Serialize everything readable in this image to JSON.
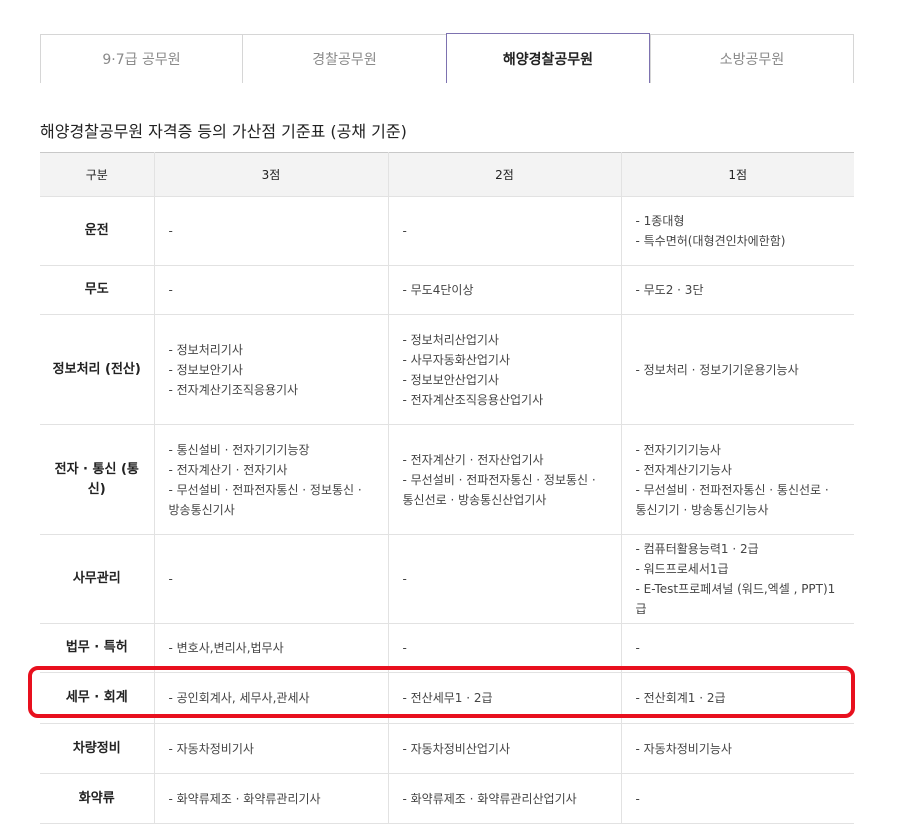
{
  "tabs": [
    {
      "label": "9·7급 공무원",
      "active": false
    },
    {
      "label": "경찰공무원",
      "active": false
    },
    {
      "label": "해양경찰공무원",
      "active": true
    },
    {
      "label": "소방공무원",
      "active": false
    }
  ],
  "title": "해양경찰공무원 자격증 등의 가산점 기준표 (공채 기준)",
  "table": {
    "headers": [
      "구분",
      "3점",
      "2점",
      "1점"
    ],
    "rows": [
      {
        "category": "운전",
        "cells": [
          [
            "-"
          ],
          [
            "-"
          ],
          [
            "- 1종대형",
            "- 특수면허(대형견인차에한함)"
          ]
        ]
      },
      {
        "category": "무도",
        "cells": [
          [
            "-"
          ],
          [
            "- 무도4단이상"
          ],
          [
            "- 무도2 · 3단"
          ]
        ]
      },
      {
        "category": "정보처리 (전산)",
        "cells": [
          [
            "- 정보처리기사",
            "- 정보보안기사",
            "- 전자계산기조직응용기사"
          ],
          [
            "- 정보처리산업기사",
            "- 사무자동화산업기사",
            "- 정보보안산업기사",
            "- 전자계산조직응용산업기사"
          ],
          [
            "- 정보처리 · 정보기기운용기능사"
          ]
        ]
      },
      {
        "category": "전자 · 통신 (통신)",
        "cells": [
          [
            "- 통신설비 · 전자기기기능장",
            "- 전자계산기 · 전자기사",
            "- 무선설비 · 전파전자통신 · 정보통신 · 방송통신기사"
          ],
          [
            "- 전자계산기 · 전자산업기사",
            "- 무선설비 · 전파전자통신 · 정보통신 · 통신선로 · 방송통신산업기사"
          ],
          [
            "- 전자기기기능사",
            "- 전자계산기기능사",
            "- 무선설비 · 전파전자통신 · 통신선로 · 통신기기 · 방송통신기능사"
          ]
        ]
      },
      {
        "category": "사무관리",
        "cells": [
          [
            "-"
          ],
          [
            "-"
          ],
          [
            "- 컴퓨터활용능력1 · 2급",
            "- 워드프로세서1급",
            "- E-Test프로페셔널 (워드,엑셀 , PPT)1급"
          ]
        ]
      },
      {
        "category": "법무 · 특허",
        "cells": [
          [
            "- 변호사,변리사,법무사"
          ],
          [
            "-"
          ],
          [
            "-"
          ]
        ]
      },
      {
        "category": "세무 · 회계",
        "cells": [
          [
            "- 공인회계사, 세무사,관세사"
          ],
          [
            "- 전산세무1 · 2급"
          ],
          [
            "- 전산회계1 · 2급"
          ]
        ]
      },
      {
        "category": "차량정비",
        "cells": [
          [
            "- 자동차정비기사"
          ],
          [
            "- 자동차정비산업기사"
          ],
          [
            "- 자동차정비기능사"
          ]
        ]
      },
      {
        "category": "화약류",
        "cells": [
          [
            "- 화약류제조 · 화약류관리기사"
          ],
          [
            "- 화약류제조 · 화약류관리산업기사"
          ],
          [
            "-"
          ]
        ]
      }
    ]
  },
  "highlight": {
    "row": "세무 · 회계",
    "color": "#e8101e"
  },
  "colors": {
    "accent": "#7d72b0",
    "header_bg": "#f3f3f3"
  }
}
